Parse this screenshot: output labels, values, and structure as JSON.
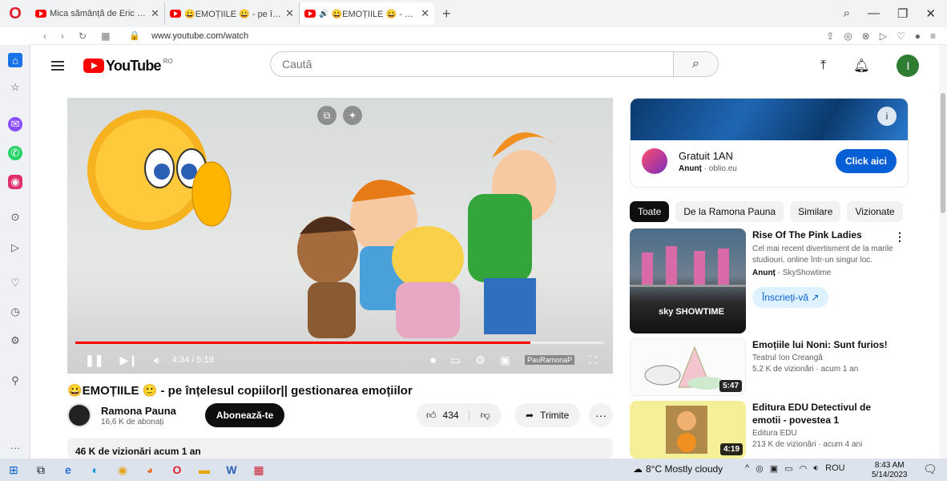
{
  "browser": {
    "tabs": [
      {
        "label": "Mica sămânță de Eric Carle",
        "active": false
      },
      {
        "label": "😀EMOȚIILE 😀 - pe înțele",
        "active": false
      },
      {
        "label": "😀EMOȚIILE 😀 - pe în",
        "active": true
      }
    ],
    "url": "www.youtube.com/watch"
  },
  "header": {
    "logo_text": "YouTube",
    "region": "RO",
    "search_placeholder": "Caută",
    "avatar_letter": "I"
  },
  "player": {
    "time": "4:34 / 5:19",
    "progress_fraction": 0.86,
    "watermark": "PauRamonaP"
  },
  "video": {
    "title": "😀EMOȚIILE 🙂 - pe înțelesul copiilor|| gestionarea emoțiilor",
    "channel_name": "Ramona Pauna",
    "subscribers": "16,6 K de abonați",
    "subscribe_label": "Abonează-te",
    "likes": "434",
    "share_label": "Trimite",
    "description_summary": "46 K de vizionări  acum 1 an"
  },
  "ad": {
    "title": "Gratuit 1AN",
    "label": "Anunț",
    "domain": "oblio.eu",
    "cta": "Click aici"
  },
  "chips": [
    "Toate",
    "De la Ramona Pauna",
    "Similare",
    "Vizionate"
  ],
  "recommendations": [
    {
      "title": "Rise Of The Pink Ladies",
      "description": "Cel mai recent divertisment de la marile studiouri, online într-un singur loc.",
      "channel": "Anunț",
      "channel_suffix": " · SkyShowtime",
      "cta": "Înscrieți-vă",
      "thumb_text": "sky SHOWTIME"
    },
    {
      "title": "Emoțiile lui Noni: Sunt furios!",
      "channel": "Teatrul Ion Creangă",
      "meta": "5,2 K de vizionări · acum 1 an",
      "duration": "5:47"
    },
    {
      "title": "Editura EDU Detectivul de emotii - povestea 1",
      "channel": "Editura EDU",
      "meta": "213 K de vizionări · acum 4 ani",
      "duration": "4:19"
    }
  ],
  "taskbar": {
    "weather": "8°C  Mostly cloudy",
    "lang": "ROU",
    "time": "8:43 AM",
    "date": "5/14/2023"
  }
}
